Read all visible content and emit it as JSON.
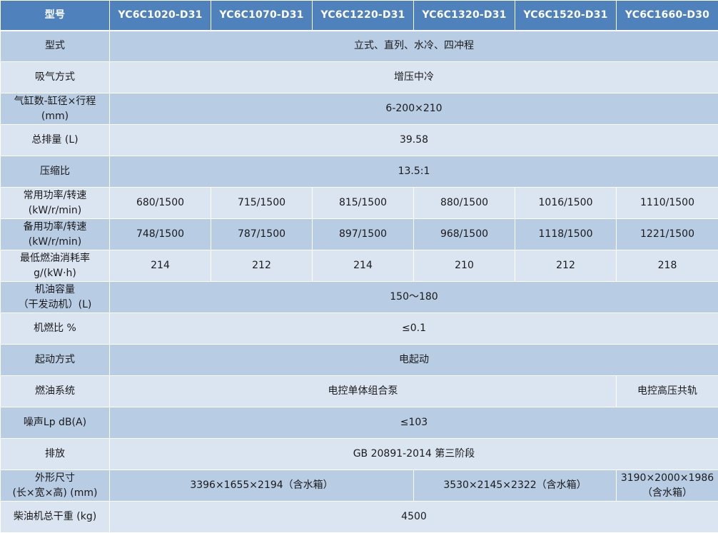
{
  "header": {
    "label": "型号",
    "models": [
      "YC6C1020-D31",
      "YC6C1070-D31",
      "YC6C1220-D31",
      "YC6C1320-D31",
      "YC6C1520-D31",
      "YC6C1660-D30"
    ]
  },
  "rows": {
    "type": {
      "label": "型式",
      "value": "立式、直列、水冷、四冲程"
    },
    "intake": {
      "label": "吸气方式",
      "value": "增压中冷"
    },
    "cylinder": {
      "label_line1": "气缸数-缸径×行程",
      "label_line2": "(mm)",
      "value": "6-200×210"
    },
    "displacement": {
      "label": "总排量 (L)",
      "value": "39.58"
    },
    "compression": {
      "label": "压缩比",
      "value": "13.5:1"
    },
    "prime_power": {
      "label_line1": "常用功率/转速",
      "label_line2": "(kW/r/min)",
      "values": [
        "680/1500",
        "715/1500",
        "815/1500",
        "880/1500",
        "1016/1500",
        "1110/1500"
      ]
    },
    "standby_power": {
      "label_line1": "备用功率/转速",
      "label_line2": "(kW/r/min)",
      "values": [
        "748/1500",
        "787/1500",
        "897/1500",
        "968/1500",
        "1118/1500",
        "1221/1500"
      ]
    },
    "fuel_consumption": {
      "label_line1": "最低燃油消耗率",
      "label_line2": "g/(kW·h)",
      "values": [
        "214",
        "212",
        "214",
        "210",
        "212",
        "218"
      ]
    },
    "oil_capacity": {
      "label_line1": "机油容量",
      "label_line2": "（干发动机）(L)",
      "value": "150～180"
    },
    "oil_fuel_ratio": {
      "label": "机燃比 %",
      "value": "≤0.1"
    },
    "start": {
      "label": "起动方式",
      "value": "电起动"
    },
    "fuel_system": {
      "label": "燃油系统",
      "value_main": "电控单体组合泵",
      "value_last": "电控高压共轨"
    },
    "noise": {
      "label": "噪声Lp dB(A)",
      "value": "≤103"
    },
    "emission": {
      "label": "排放",
      "value": "GB 20891-2014 第三阶段"
    },
    "dimensions": {
      "label_line1": "外形尺寸",
      "label_line2": "(长×宽×高) (mm)",
      "value_a": "3396×1655×2194（含水箱）",
      "value_b": "3530×2145×2322（含水箱）",
      "value_c_line1": "3190×2000×1986",
      "value_c_line2": "（含水箱）"
    },
    "weight": {
      "label": "柴油机总干重 (kg)",
      "value": "4500"
    }
  }
}
